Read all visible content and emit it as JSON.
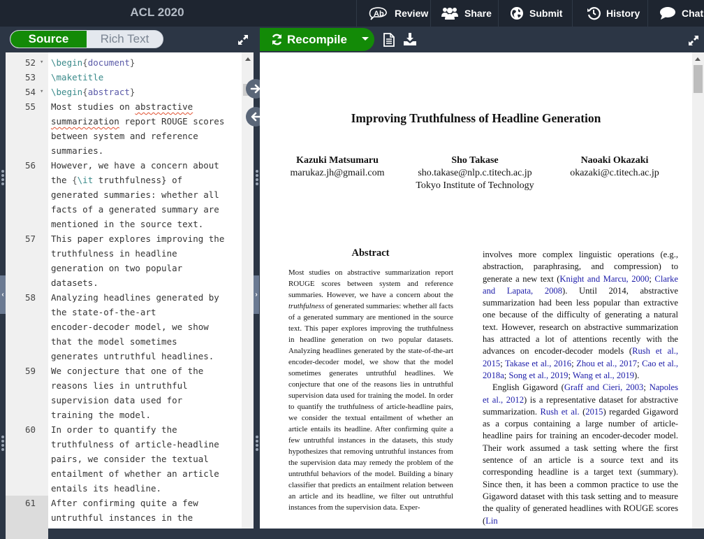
{
  "header": {
    "project_title": "ACL 2020",
    "nav": [
      {
        "label": "Review",
        "icon": "review-icon"
      },
      {
        "label": "Share",
        "icon": "users-icon"
      },
      {
        "label": "Submit",
        "icon": "globe-icon"
      },
      {
        "label": "History",
        "icon": "history-icon"
      },
      {
        "label": "Chat",
        "icon": "chat-bubble-icon"
      }
    ]
  },
  "toolbar": {
    "source_label": "Source",
    "rich_text_label": "Rich Text",
    "recompile_label": "Recompile",
    "active_mode": "Source"
  },
  "editor": {
    "lines": [
      {
        "n": "52",
        "fold": true,
        "rows": [
          "\\begin{document}"
        ]
      },
      {
        "n": "53",
        "fold": false,
        "rows": [
          "\\maketitle"
        ]
      },
      {
        "n": "54",
        "fold": true,
        "rows": [
          "\\begin{abstract}"
        ]
      },
      {
        "n": "55",
        "fold": false,
        "rows": [
          "Most studies on abstractive",
          "summarization report ROUGE scores",
          "between system and reference",
          "summaries."
        ]
      },
      {
        "n": "56",
        "fold": false,
        "rows": [
          "However, we have a concern about",
          "the {\\it truthfulness} of",
          "generated summaries: whether all",
          "facts of a generated summary are",
          "mentioned in the source text."
        ]
      },
      {
        "n": "57",
        "fold": false,
        "rows": [
          "This paper explores improving the",
          "truthfulness in headline",
          "generation on two popular",
          "datasets."
        ]
      },
      {
        "n": "58",
        "fold": false,
        "rows": [
          "Analyzing headlines generated by",
          "the state-of-the-art",
          "encoder-decoder model, we show",
          "that the model sometimes",
          "generates untruthful headlines."
        ]
      },
      {
        "n": "59",
        "fold": false,
        "rows": [
          "We conjecture that one of the",
          "reasons lies in untruthful",
          "supervision data used for",
          "training the model."
        ]
      },
      {
        "n": "60",
        "fold": false,
        "rows": [
          "In order to quantify the",
          "truthfulness of article-headline",
          "pairs, we consider the textual",
          "entailment of whether an article",
          "entails its headline."
        ]
      },
      {
        "n": "61",
        "fold": false,
        "active": true,
        "rows": [
          "After confirming quite a few",
          "untruthful instances in the"
        ]
      }
    ],
    "spellcheck_flagged": [
      "abstractive",
      "summarization"
    ]
  },
  "pdf": {
    "title": "Improving Truthfulness of Headline Generation",
    "authors": [
      {
        "name": "Kazuki Matsumaru",
        "email": "marukaz.jh@gmail.com",
        "affiliation": ""
      },
      {
        "name": "Sho Takase",
        "email": "sho.takase@nlp.c.titech.ac.jp",
        "affiliation": "Tokyo Institute of Technology"
      },
      {
        "name": "Naoaki Okazaki",
        "email": "okazaki@c.titech.ac.jp",
        "affiliation": ""
      }
    ],
    "abstract_heading": "Abstract",
    "abstract_text_before_italic": "Most studies on abstractive summarization report ROUGE scores between system and reference summaries. However, we have a concern about the ",
    "abstract_italic": "truthfulness",
    "abstract_text_after_italic": " of generated summaries: whether all facts of a generated summary are mentioned in the source text. This paper explores improving the truthfulness in headline generation on two popular datasets. Analyzing headlines generated by the state-of-the-art encoder-decoder model, we show that the model sometimes generates untruthful headlines. We conjecture that one of the reasons lies in untruthful supervision data used for training the model. In order to quantify the truthfulness of article-headline pairs, we consider the textual entailment of whether an article entails its headline. After confirming quite a few untruthful instances in the datasets, this study hypothesizes that removing untruthful instances from the supervision data may remedy the problem of the untruthful behaviors of the model. Building a binary classifier that predicts an entailment relation between an article and its headline, we filter out untruthful instances from the supervision data. Exper-",
    "right_column": {
      "p1_a": "involves more complex linguistic operations (e.g., abstraction, paraphrasing, and compression) to generate a new text (",
      "cite1": "Knight and Marcu, 2000",
      "p1_sep1": "; ",
      "cite2": "Clarke and Lapata, 2008",
      "p1_b": "). Until 2014, abstractive summarization had been less popular than extractive one because of the difficulty of generating a natural text. However, research on abstractive summarization has attracted a lot of attentions recently with the advances on encoder-decoder models (",
      "cite3": "Rush et al., 2015",
      "cite4": "Takase et al., 2016",
      "cite5": "Zhou et al., 2017",
      "cite6": "Cao et al., 2018a",
      "cite7": "Song et al., 2019",
      "cite8": "Wang et al., 2019",
      "p1_end": ").",
      "p2_a": "English Gigaword (",
      "cite9": "Graff and Cieri, 2003",
      "cite10": "Napoles et al., 2012",
      "p2_b": ") is a representative dataset for abstractive summarization. ",
      "cite11": "Rush et al.",
      "cite11_year": "2015",
      "p2_c": " regarded Gigaword as a corpus containing a large number of article-headline pairs for training an encoder-decoder model. Their work assumed a task setting where the first sentence of an article is a source text and its corresponding headline is a target text (summary). Since then, it has been a common practice to use the Gigaword dataset with this task setting and to measure the quality of generated headlines with ROUGE scores (",
      "cite12": "Lin"
    }
  },
  "colors": {
    "accent_green": "#138a07",
    "header_bg": "#1e2530",
    "toolbar_bg": "#2c3645",
    "citation_blue": "#1a1aa8",
    "spellcheck_red": "#e05030"
  }
}
